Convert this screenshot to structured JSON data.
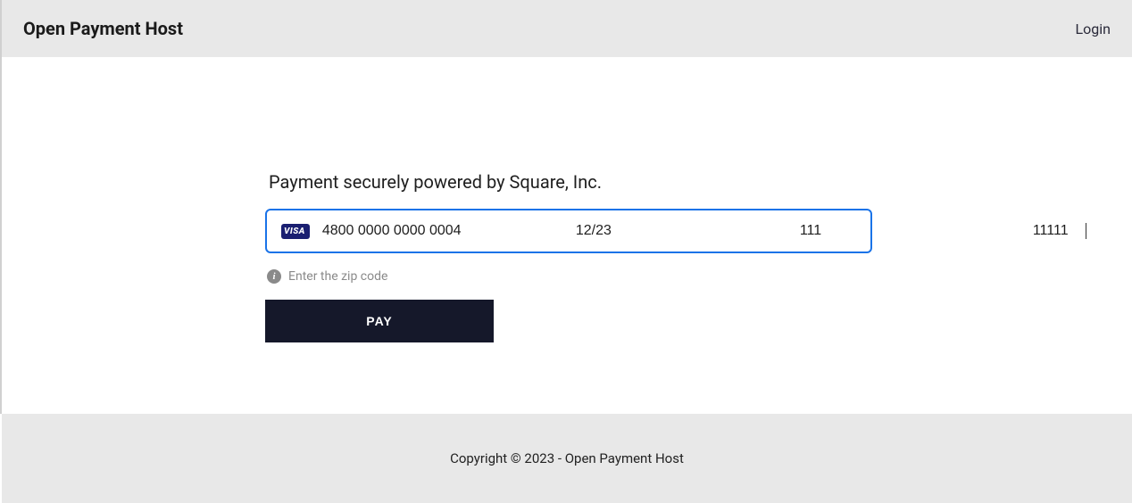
{
  "header": {
    "app_title": "Open Payment Host",
    "login_label": "Login"
  },
  "payment": {
    "heading": "Payment securely powered by Square, Inc.",
    "card_brand": "VISA",
    "card_number": "4800 0000 0000 0004",
    "card_exp": "12/23",
    "card_cvv": "111",
    "card_zip": "11111",
    "hint_text": "Enter the zip code",
    "pay_button_label": "PAY"
  },
  "footer": {
    "copyright": "Copyright © 2023 - Open Payment Host"
  },
  "colors": {
    "header_bg": "#e8e8e8",
    "focus_border": "#1a73e8",
    "visa_bg": "#1a1f71",
    "pay_bg": "#15182a"
  }
}
